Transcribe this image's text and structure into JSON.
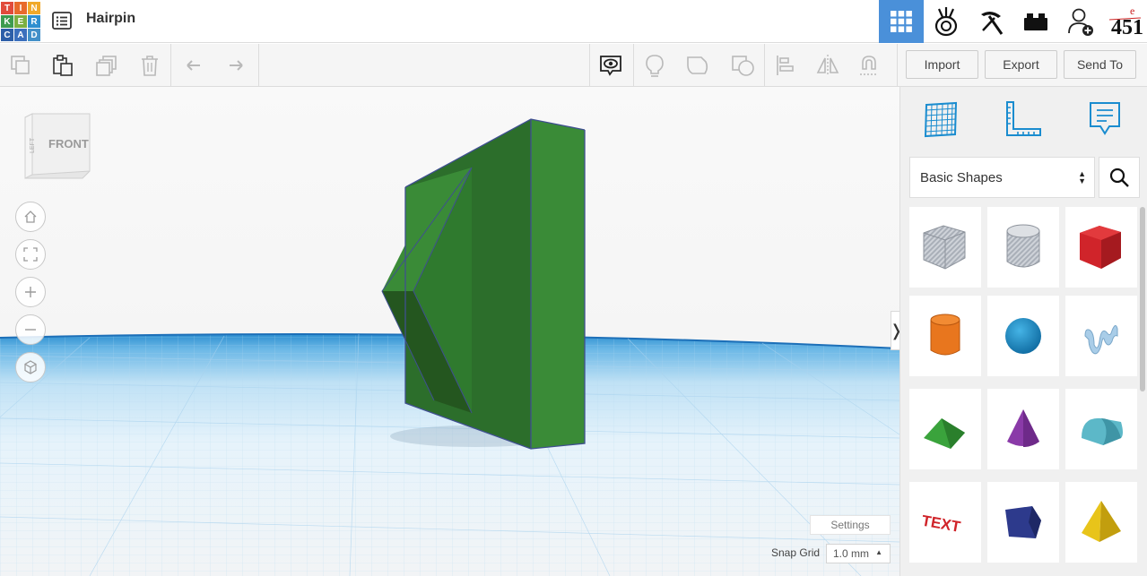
{
  "app": {
    "design_title": "Hairpin",
    "logo_letters": [
      "T",
      "I",
      "N",
      "K",
      "E",
      "R",
      "C",
      "A",
      "D"
    ],
    "logo_colors": [
      "#e14b3c",
      "#e86a2b",
      "#f0a92a",
      "#3d9b4f",
      "#7bb042",
      "#2f8fcf",
      "#2d5ea8",
      "#3b6fbd",
      "#4390c9"
    ],
    "accent_color": "#4a90d9"
  },
  "topbar": {
    "icons": [
      "3d-design-icon",
      "circuits-icon",
      "codeblocks-icon",
      "lego-bricks-icon",
      "add-user-icon",
      "user-avatar"
    ],
    "avatar_text": "451"
  },
  "toolbar": {
    "import_label": "Import",
    "export_label": "Export",
    "send_to_label": "Send To"
  },
  "viewcube": {
    "front_label": "FRONT",
    "left_label": "LEFT"
  },
  "workplane": {
    "settings_label": "Settings",
    "snap_grid_label": "Snap Grid",
    "snap_grid_value": "1.0 mm",
    "object_color": "#3a8b37"
  },
  "panel": {
    "category": "Basic Shapes",
    "shapes": [
      {
        "name": "Box Hole",
        "color": "#b8bcc4"
      },
      {
        "name": "Cylinder Hole",
        "color": "#b8bcc4"
      },
      {
        "name": "Box",
        "color": "#d0242a"
      },
      {
        "name": "Cylinder",
        "color": "#e8761e"
      },
      {
        "name": "Sphere",
        "color": "#1a92cf"
      },
      {
        "name": "Scribble",
        "color": "#9ec4e2"
      },
      {
        "name": "Roof",
        "color": "#3aa33c"
      },
      {
        "name": "Cone",
        "color": "#8a3aa8"
      },
      {
        "name": "Round Roof",
        "color": "#5cb8c8"
      },
      {
        "name": "Text",
        "color": "#d0242a"
      },
      {
        "name": "Polygon",
        "color": "#2d3a8c"
      },
      {
        "name": "Pyramid",
        "color": "#e8c41a"
      }
    ],
    "text_shape_label": "TEXT"
  }
}
